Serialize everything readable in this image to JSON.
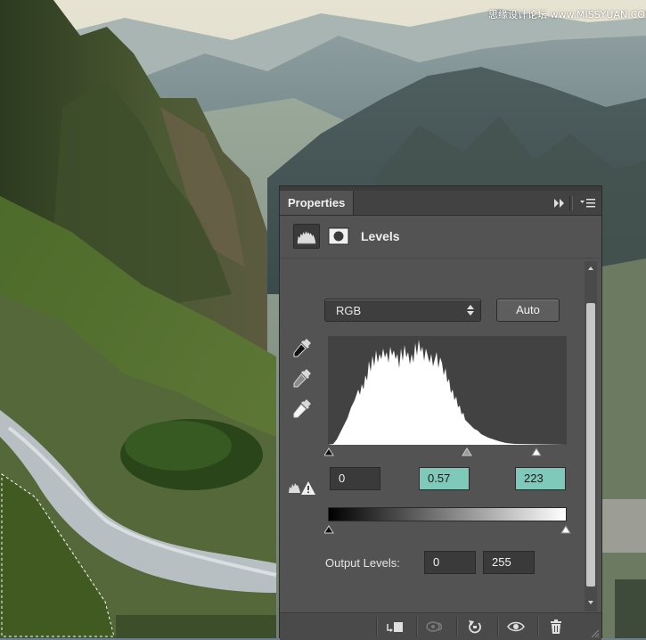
{
  "watermark": "思缘设计论坛 www.MISSYUAN.COM",
  "panel": {
    "tab_label": "Properties",
    "title": "Levels",
    "channel": "RGB",
    "auto_label": "Auto",
    "input_levels": {
      "black": "0",
      "gamma": "0.57",
      "white": "223"
    },
    "output_label": "Output Levels:",
    "output_levels": {
      "black": "0",
      "white": "255"
    }
  },
  "colors": {
    "panel_bg": "#535353",
    "field_highlight": "#7fc9bb",
    "field_dark": "#3a3a3a"
  },
  "icons": [
    "collapse-arrows-icon",
    "panel-menu-icon",
    "histogram-icon",
    "mask-icon",
    "black-eyedropper-icon",
    "gray-eyedropper-icon",
    "white-eyedropper-icon",
    "clipping-warning-icon",
    "clip-to-layer-icon",
    "view-previous-icon",
    "reset-icon",
    "eye-icon",
    "trash-icon"
  ]
}
